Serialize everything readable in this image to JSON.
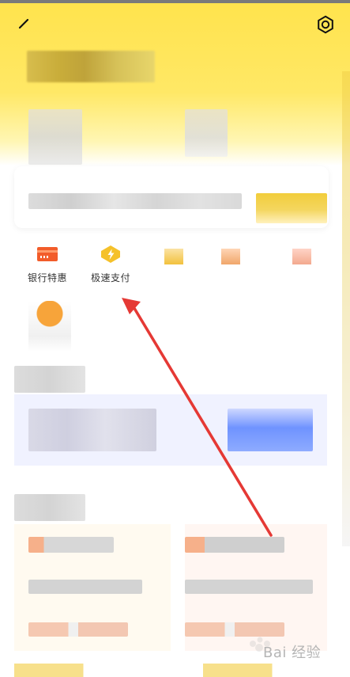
{
  "quick_actions": [
    {
      "label": "银行特惠",
      "icon": "bank-card-icon"
    },
    {
      "label": "极速支付",
      "icon": "lightning-icon"
    }
  ],
  "watermark": {
    "text": "Bai 经验"
  },
  "colors": {
    "header_yellow": "#ffe34d",
    "arrow_red": "#e53935",
    "orange": "#f25c2a",
    "yellow": "#f5c12a",
    "blue_accent": "#6f93ff"
  }
}
